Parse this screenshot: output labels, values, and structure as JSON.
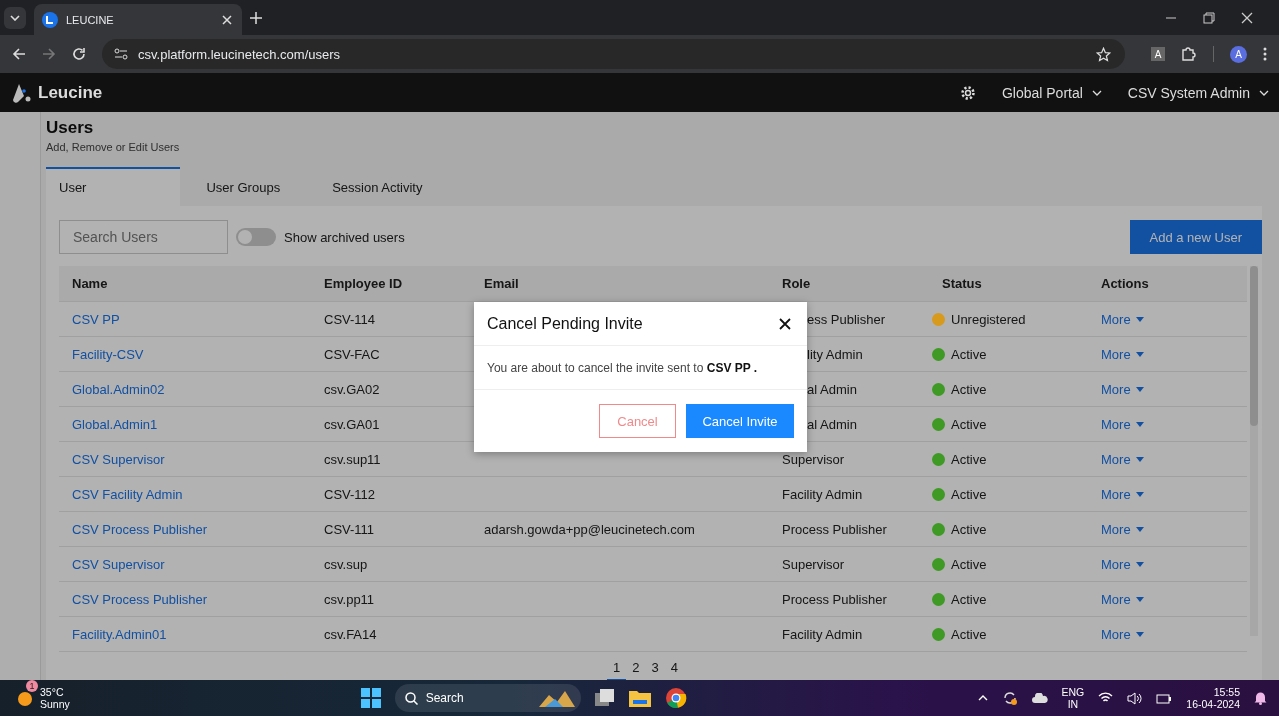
{
  "browser": {
    "tab_title": "LEUCINE",
    "url": "csv.platform.leucinetech.com/users",
    "extension_label": "A",
    "profile_initial": "A"
  },
  "header": {
    "brand": "Leucine",
    "portal": "Global Portal",
    "user": "CSV System Admin"
  },
  "page": {
    "title": "Users",
    "subtitle": "Add, Remove or Edit Users"
  },
  "tabs": [
    {
      "label": "User",
      "selected": true
    },
    {
      "label": "User Groups",
      "selected": false
    },
    {
      "label": "Session Activity",
      "selected": false
    }
  ],
  "search": {
    "placeholder": "Search Users"
  },
  "archived_toggle": {
    "label": "Show archived users",
    "on": false
  },
  "add_button": "Add a new User",
  "table": {
    "columns": [
      "Name",
      "Employee ID",
      "Email",
      "Role",
      "Status",
      "Actions"
    ],
    "rows": [
      {
        "name": "CSV PP",
        "employee_id": "CSV-114",
        "role": "ess Publisher",
        "status": "Unregistered",
        "color": "#d89a1c",
        "action": "More"
      },
      {
        "name": "Facility-CSV",
        "employee_id": "CSV-FAC",
        "role": "lity Admin",
        "status": "Active",
        "color": "#3f9a25",
        "action": "More"
      },
      {
        "name": "Global.Admin02",
        "employee_id": "csv.GA02",
        "role": "al Admin",
        "status": "Active",
        "color": "#3f9a25",
        "action": "More"
      },
      {
        "name": "Global.Admin1",
        "employee_id": "csv.GA01",
        "role": "al Admin",
        "status": "Active",
        "color": "#3f9a25",
        "action": "More"
      },
      {
        "name": "CSV Supervisor",
        "employee_id": "csv.sup11",
        "role": "Supervisor",
        "status": "Active",
        "color": "#3f9a25",
        "action": "More"
      },
      {
        "name": "CSV Facility Admin",
        "employee_id": "CSV-112",
        "role": "Facility Admin",
        "status": "Active",
        "color": "#3f9a25",
        "action": "More"
      },
      {
        "name": "CSV Process Publisher",
        "employee_id": "CSV-111",
        "email": "adarsh.gowda+pp@leucinetech.com",
        "role": "Process Publisher",
        "status": "Active",
        "color": "#3f9a25",
        "action": "More"
      },
      {
        "name": "CSV Supervisor",
        "employee_id": "csv.sup",
        "role": "Supervisor",
        "status": "Active",
        "color": "#3f9a25",
        "action": "More"
      },
      {
        "name": "CSV Process Publisher",
        "employee_id": "csv.pp11",
        "role": "Process Publisher",
        "status": "Active",
        "color": "#3f9a25",
        "action": "More"
      },
      {
        "name": "Facility.Admin01",
        "employee_id": "csv.FA14",
        "role": "Facility Admin",
        "status": "Active",
        "color": "#3f9a25",
        "action": "More"
      }
    ]
  },
  "pagination": [
    {
      "label": "1",
      "selected": true
    },
    {
      "label": "2",
      "selected": false
    },
    {
      "label": "3",
      "selected": false
    },
    {
      "label": "4",
      "selected": false
    }
  ],
  "modal": {
    "title": "Cancel Pending Invite",
    "message": "You are about to cancel the invite sent to **CSV PP .**",
    "cancel": "Cancel",
    "confirm": "Cancel Invite"
  },
  "taskbar": {
    "weather_badge": "1",
    "temperature": "35°C",
    "condition": "Sunny",
    "search": "Search",
    "language": "ENG",
    "region": "IN",
    "time": "15:55",
    "date": "16-04-2024"
  }
}
